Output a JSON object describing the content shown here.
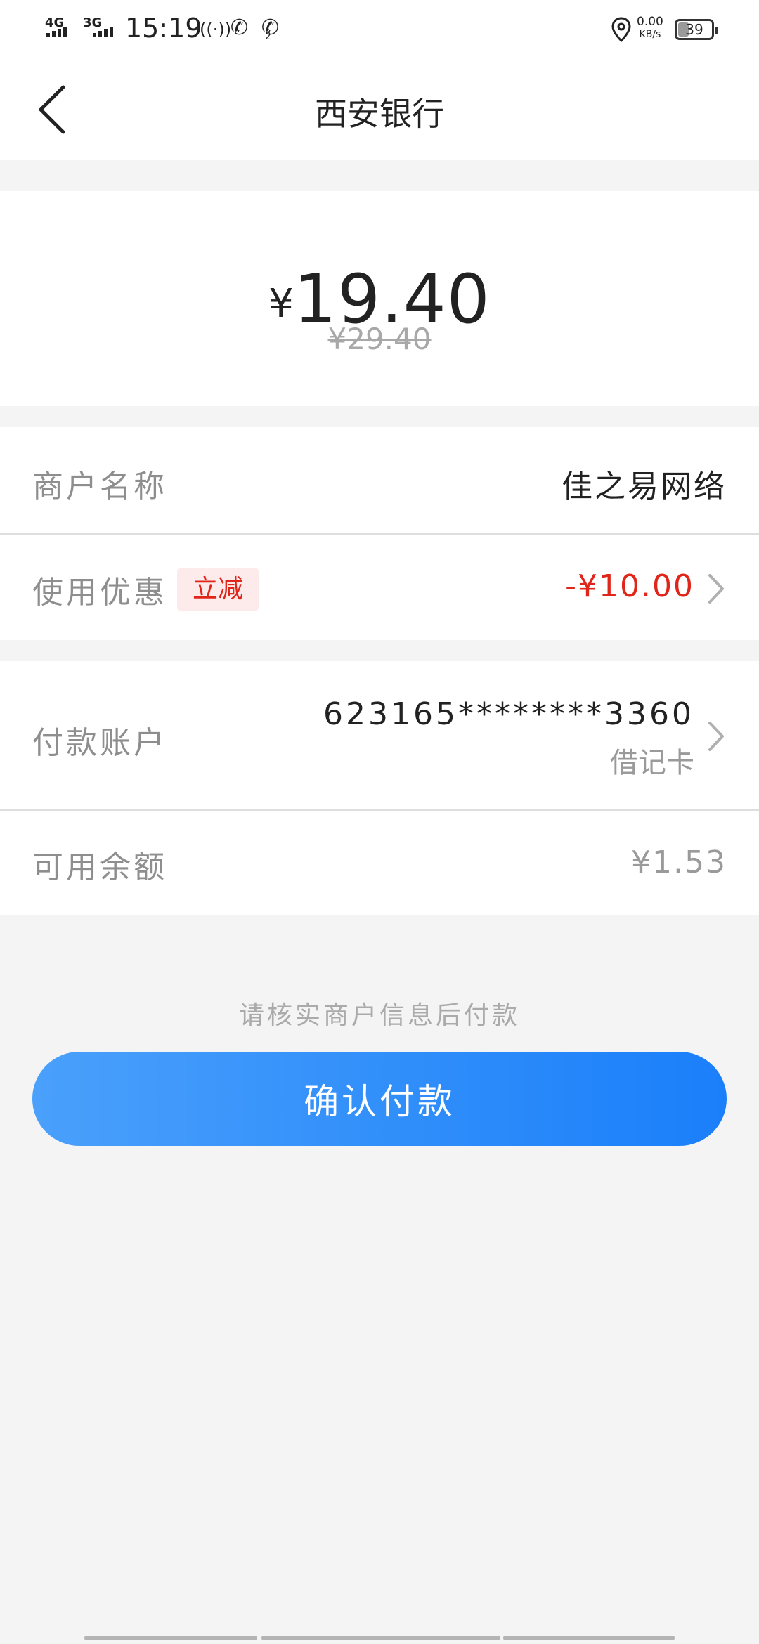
{
  "status_bar": {
    "signal1": "4G",
    "signal2": "3G",
    "time": "15:19",
    "net_speed_value": "0.00",
    "net_speed_unit": "KB/s",
    "battery": "39",
    "sim2_label": "2"
  },
  "nav": {
    "title": "西安银行"
  },
  "amount": {
    "currency": "¥",
    "value": "19.40",
    "original": "¥29.40"
  },
  "merchant": {
    "label": "商户名称",
    "value": "佳之易网络"
  },
  "discount": {
    "label": "使用优惠",
    "tag": "立减",
    "value": "-¥10.00"
  },
  "account": {
    "label": "付款账户",
    "number": "623165********3360",
    "type": "借记卡"
  },
  "balance": {
    "label": "可用余额",
    "value": "¥1.53"
  },
  "notice": "请核实商户信息后付款",
  "confirm_button": "确认付款",
  "colors": {
    "accent_start": "#4aa0fb",
    "accent_end": "#1a7ffa",
    "discount_red": "#e0251a",
    "background": "#f4f4f4"
  }
}
